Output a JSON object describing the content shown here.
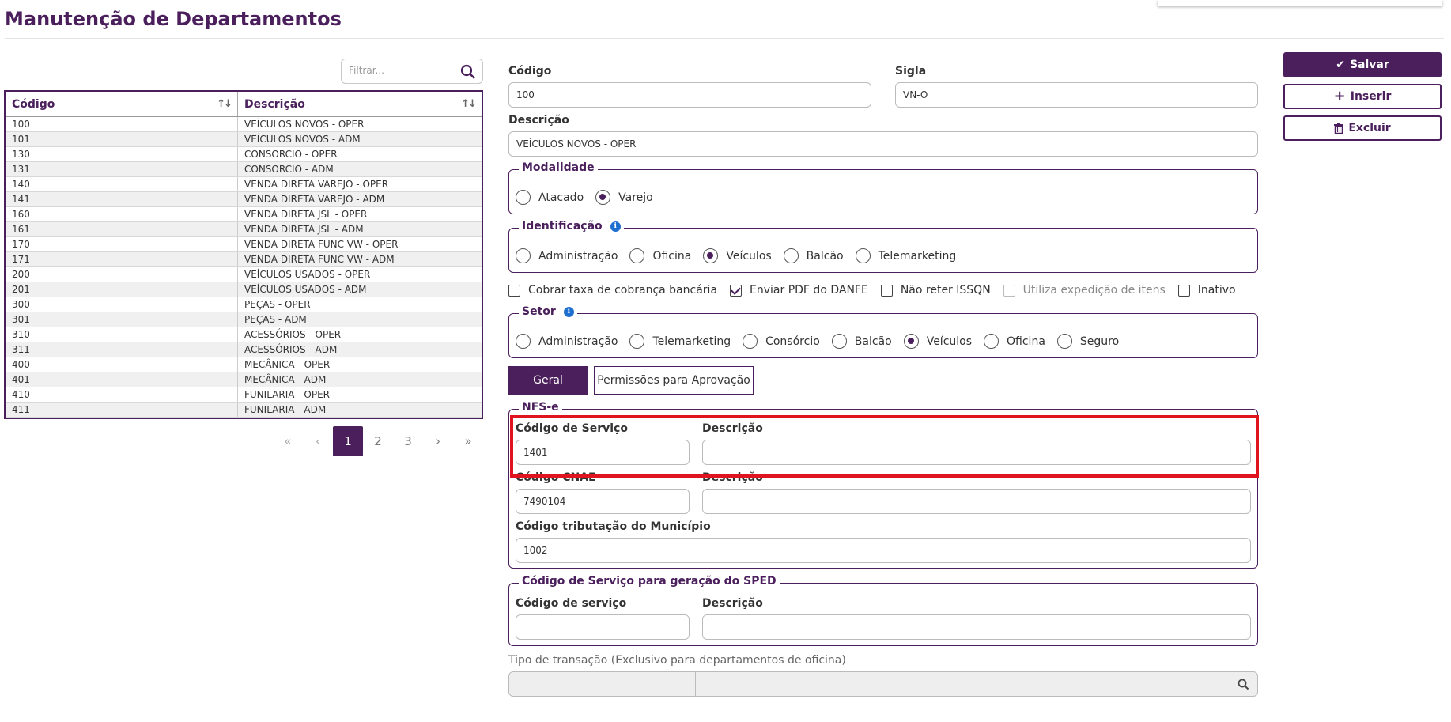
{
  "page": {
    "title": "Manutenção de Departamentos"
  },
  "filter": {
    "placeholder": "Filtrar...",
    "icon": "search-icon"
  },
  "table": {
    "headers": [
      "Código",
      "Descrição"
    ],
    "rows": [
      [
        "100",
        "VEÍCULOS NOVOS - OPER"
      ],
      [
        "101",
        "VEÍCULOS NOVOS - ADM"
      ],
      [
        "130",
        "CONSORCIO - OPER"
      ],
      [
        "131",
        "CONSORCIO - ADM"
      ],
      [
        "140",
        "VENDA DIRETA VAREJO - OPER"
      ],
      [
        "141",
        "VENDA DIRETA VAREJO - ADM"
      ],
      [
        "160",
        "VENDA DIRETA JSL - OPER"
      ],
      [
        "161",
        "VENDA DIRETA JSL - ADM"
      ],
      [
        "170",
        "VENDA DIRETA FUNC VW - OPER"
      ],
      [
        "171",
        "VENDA DIRETA FUNC VW - ADM"
      ],
      [
        "200",
        "VEÍCULOS USADOS - OPER"
      ],
      [
        "201",
        "VEÍCULOS USADOS - ADM"
      ],
      [
        "300",
        "PEÇAS - OPER"
      ],
      [
        "301",
        "PEÇAS - ADM"
      ],
      [
        "310",
        "ACESSÓRIOS - OPER"
      ],
      [
        "311",
        "ACESSÓRIOS - ADM"
      ],
      [
        "400",
        "MECÂNICA - OPER"
      ],
      [
        "401",
        "MECÂNICA - ADM"
      ],
      [
        "410",
        "FUNILARIA - OPER"
      ],
      [
        "411",
        "FUNILARIA - ADM"
      ]
    ]
  },
  "pagination": {
    "first": "«",
    "prev": "‹",
    "pages": [
      "1",
      "2",
      "3"
    ],
    "current": "1",
    "next": "›",
    "last": "»"
  },
  "form": {
    "codigo": {
      "label": "Código",
      "value": "100"
    },
    "sigla": {
      "label": "Sigla",
      "value": "VN-O"
    },
    "descricao": {
      "label": "Descrição",
      "value": "VEÍCULOS NOVOS - OPER"
    },
    "modalidade": {
      "legend": "Modalidade",
      "options": [
        "Atacado",
        "Varejo"
      ],
      "selected": "Varejo"
    },
    "identificacao": {
      "legend": "Identificação",
      "options": [
        "Administração",
        "Oficina",
        "Veículos",
        "Balcão",
        "Telemarketing"
      ],
      "selected": "Veículos"
    },
    "checkboxes": [
      {
        "label": "Cobrar taxa de cobrança bancária",
        "checked": false,
        "disabled": false
      },
      {
        "label": "Enviar PDF do DANFE",
        "checked": true,
        "disabled": false
      },
      {
        "label": "Não reter ISSQN",
        "checked": false,
        "disabled": false
      },
      {
        "label": "Utiliza expedição de itens",
        "checked": false,
        "disabled": true
      },
      {
        "label": "Inativo",
        "checked": false,
        "disabled": false
      }
    ],
    "setor": {
      "legend": "Setor",
      "options": [
        "Administração",
        "Telemarketing",
        "Consórcio",
        "Balcão",
        "Veículos",
        "Oficina",
        "Seguro"
      ],
      "selected": "Veículos"
    },
    "tabs": [
      "Geral",
      "Permissões para Aprovação"
    ],
    "nfse": {
      "legend": "NFS-e",
      "codigo_servico": {
        "label": "Código de Serviço",
        "value": "1401"
      },
      "descricao_servico": {
        "label": "Descrição",
        "value": ""
      },
      "codigo_cnae": {
        "label": "Código CNAE",
        "value": "7490104"
      },
      "descricao_cnae": {
        "label": "Descrição",
        "value": ""
      },
      "codigo_tributacao": {
        "label": "Código tributação do Município",
        "value": "1002"
      }
    },
    "sped": {
      "legend": "Código de Serviço para geração do SPED",
      "codigo": {
        "label": "Código de serviço",
        "value": ""
      },
      "descricao": {
        "label": "Descrição",
        "value": ""
      }
    },
    "tipo_transacao": {
      "label": "Tipo de transação (Exclusivo para departamentos de oficina)"
    }
  },
  "actions": {
    "save": "Salvar",
    "insert": "Inserir",
    "delete": "Excluir"
  },
  "colors": {
    "primary": "#4a1f5c",
    "highlight": "#e0141e",
    "info": "#1f6fd1"
  }
}
